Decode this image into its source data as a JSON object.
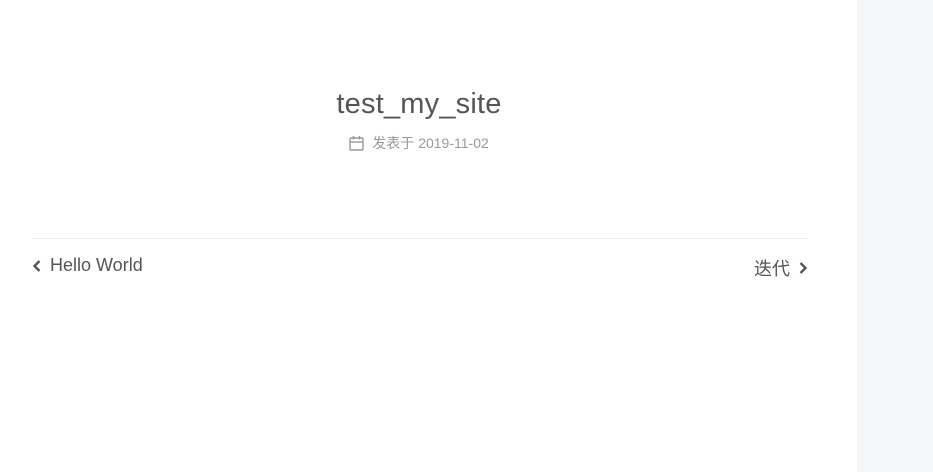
{
  "post": {
    "title": "test_my_site",
    "meta_label": "发表于",
    "date": "2019-11-02"
  },
  "pagination": {
    "prev_label": "Hello World",
    "next_label": "迭代"
  },
  "icons": {
    "meta": "calendar-icon",
    "prev": "chevron-left-icon",
    "next": "chevron-right-icon"
  },
  "colors": {
    "title": "#555555",
    "meta": "#999999",
    "sidebar_bg": "#f5f6f8",
    "divider": "#eeeeee"
  }
}
